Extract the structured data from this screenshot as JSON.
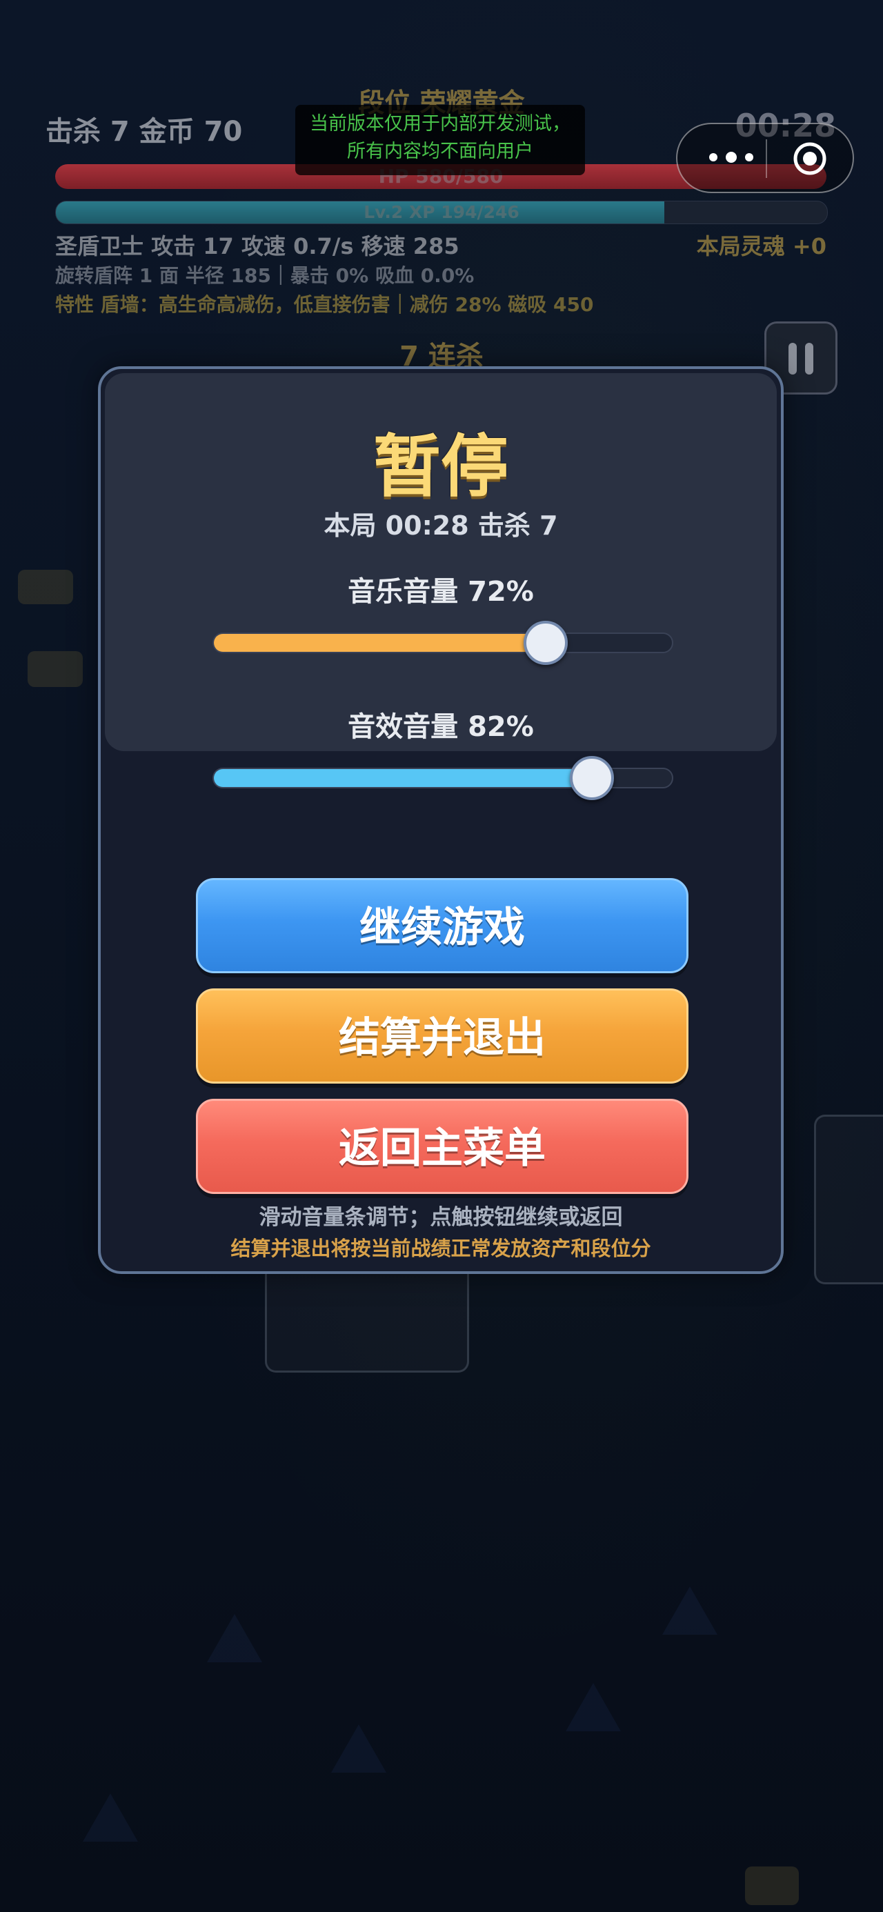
{
  "hud": {
    "stats": "击杀 7  金币 70",
    "timer": "00:28",
    "rank": "段位 荣耀黄金",
    "dev_banner_line1": "当前版本仅用于内部开发测试，",
    "dev_banner_line2": "所有内容均不面向用户",
    "hp_text": "HP 580/580",
    "hp_fraction": 1.0,
    "xp_text": "Lv.2  XP 194/246",
    "xp_fraction": 0.789,
    "line1": "圣盾卫士  攻击 17   攻速 0.7/s   移速 285",
    "soul": "本局灵魂 +0",
    "line2": "旋转盾阵 1 面  半径 185｜暴击 0% 吸血 0.0%",
    "line3": "特性 盾墙：高生命高减伤，低直接伤害｜减伤 28% 磁吸 450",
    "combo": "7 连杀"
  },
  "capsule": {
    "menu_icon": "more-dots-icon",
    "close_icon": "target-circle-icon"
  },
  "pause_icon": "pause-icon",
  "modal": {
    "title": "暂停",
    "subtitle": "本局 00:28  击杀 7",
    "music_label": "音乐音量  72%",
    "music_value": 0.72,
    "music_color": "#f9b24c",
    "sfx_label": "音效音量  82%",
    "sfx_value": 0.82,
    "sfx_color": "#57c6f5",
    "continue_label": "继续游戏",
    "settle_label": "结算并退出",
    "menu_label": "返回主菜单",
    "hint1": "滑动音量条调节；点触按钮继续或返回",
    "hint2": "结算并退出将按当前战绩正常发放资产和段位分"
  }
}
